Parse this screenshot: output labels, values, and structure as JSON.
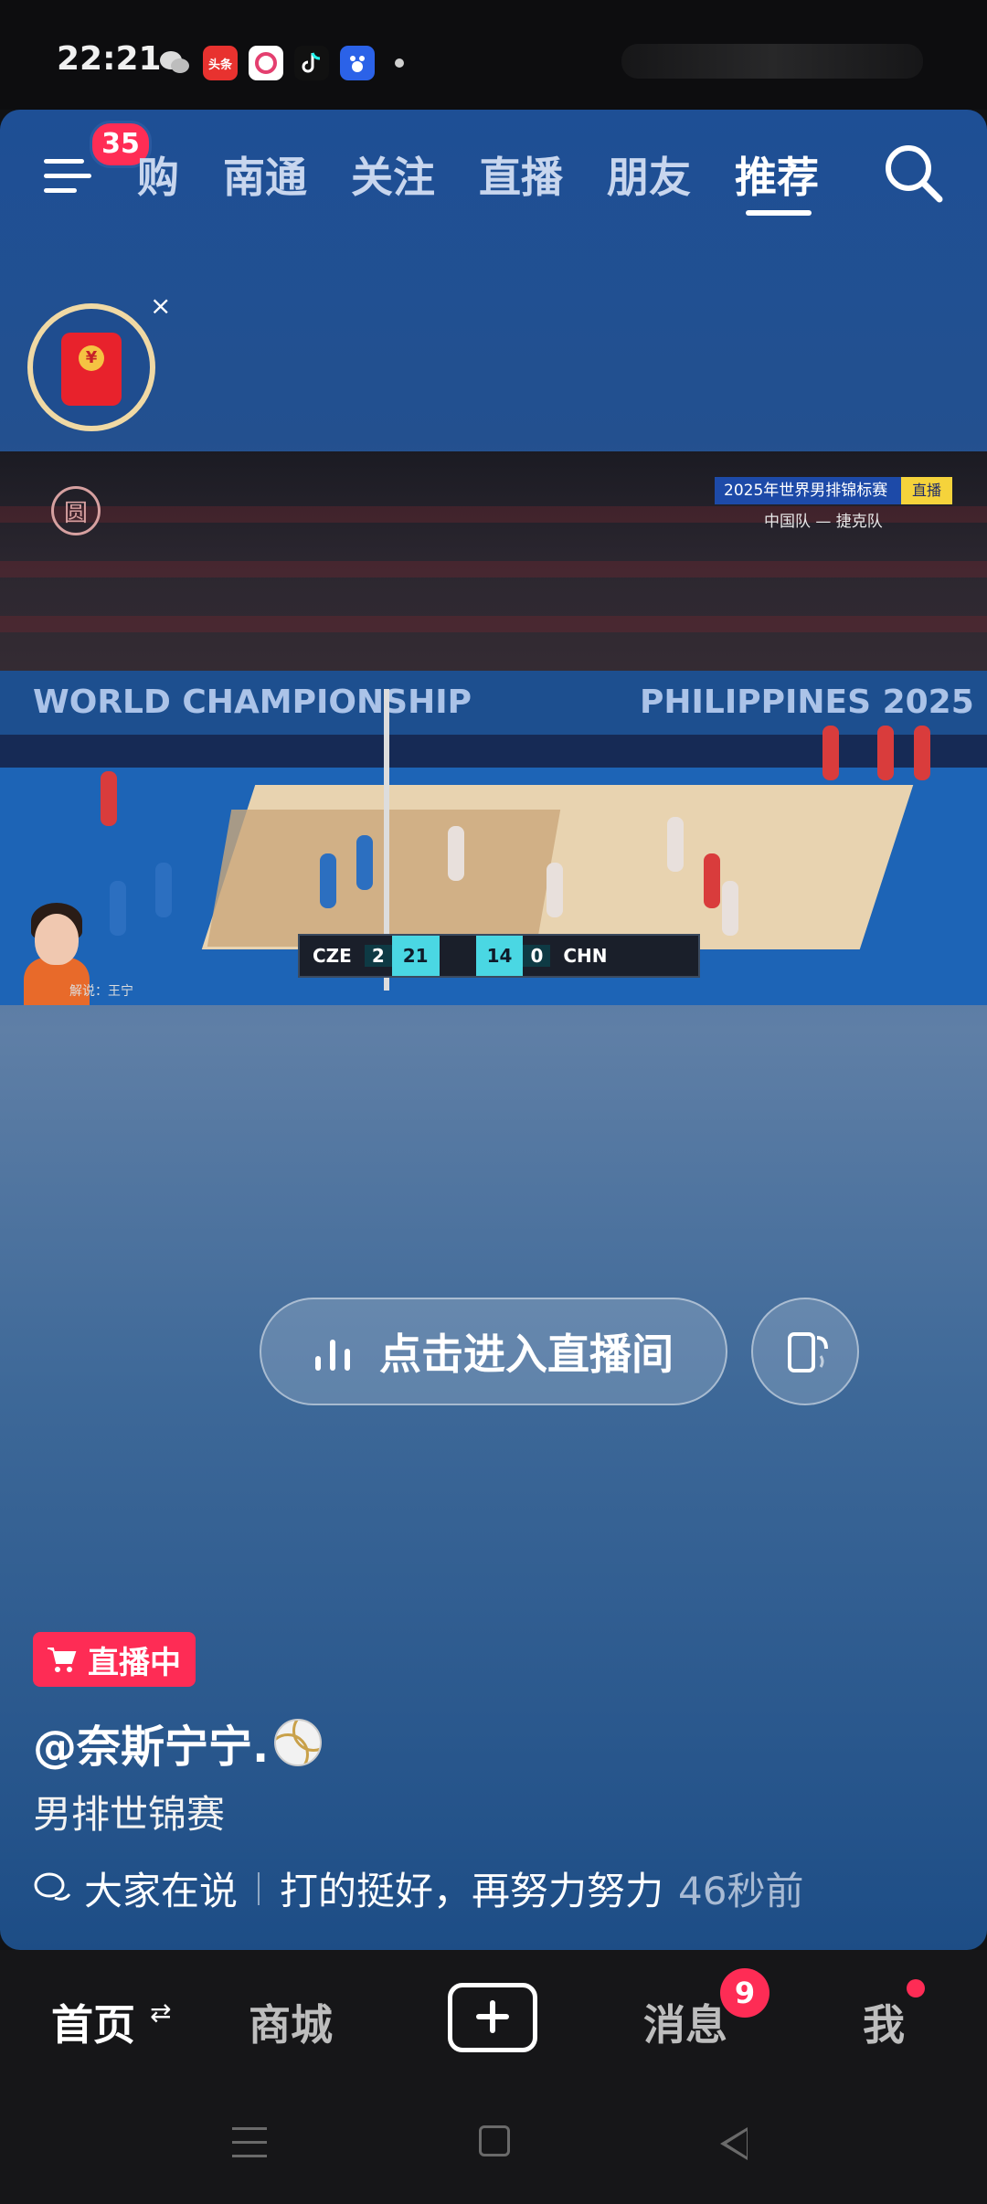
{
  "status": {
    "time": "22:21",
    "app_icons": [
      "wechat-icon",
      "toutiao-icon",
      "baidu-app-icon",
      "douyin-icon",
      "baidu-icon"
    ],
    "toutiao_label": "头条"
  },
  "top_nav": {
    "menu_badge": "35",
    "tabs": [
      {
        "label": "购",
        "active": false
      },
      {
        "label": "南通",
        "active": false
      },
      {
        "label": "关注",
        "active": false
      },
      {
        "label": "直播",
        "active": false
      },
      {
        "label": "朋友",
        "active": false
      },
      {
        "label": "推荐",
        "active": true
      }
    ]
  },
  "red_packet": {
    "close": "×",
    "coin": "¥"
  },
  "video": {
    "tv_logo": "圆",
    "event_tag": "2025年世界男排锦标赛",
    "live_flag": "直播",
    "matchup": "中国队 — 捷克队",
    "banner_left": "WORLD CHAMPIONSHIP",
    "banner_right": "PHILIPPINES 2025",
    "score": {
      "team_a": "CZE",
      "sets_a": "2",
      "points_a": "21",
      "points_b": "14",
      "sets_b": "0",
      "team_b": "CHN"
    },
    "commentator_label": "解说：王宁"
  },
  "cta": {
    "label": "点击进入直播间"
  },
  "info": {
    "live_badge": "直播中",
    "author": "@奈斯宁宁.",
    "description": "男排世锦赛",
    "comment_prefix": "大家在说",
    "comment_text": "打的挺好，再努力努力",
    "comment_time": "46秒前"
  },
  "bottom_nav": {
    "home": "首页",
    "home_switch": "⇄",
    "mall": "商城",
    "messages": "消息",
    "messages_badge": "9",
    "me": "我"
  },
  "colors": {
    "accent": "#fe2c55",
    "card_top": "#1e4f95",
    "nav_bg": "#161618"
  }
}
